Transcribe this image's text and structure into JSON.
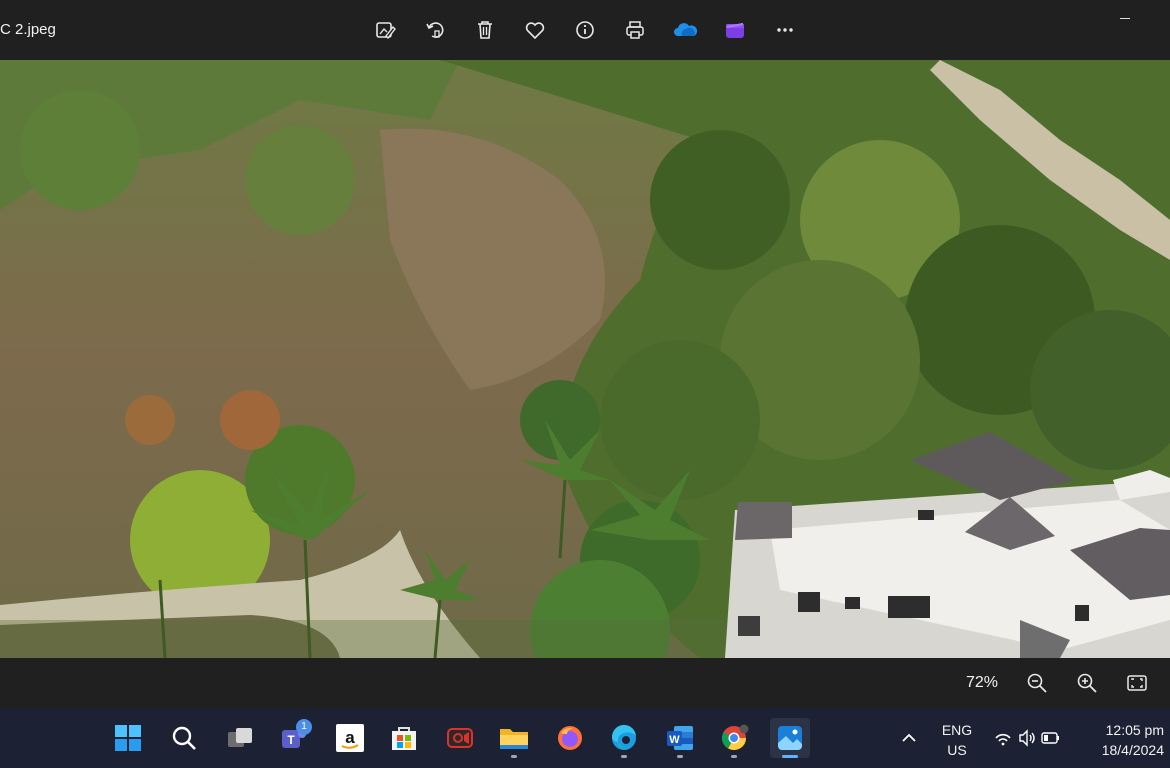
{
  "window": {
    "title": "C 2.jpeg"
  },
  "toolbar": {
    "icons": [
      "edit-image-icon",
      "rotate-icon",
      "delete-icon",
      "favorite-icon",
      "info-icon",
      "print-icon",
      "onedrive-icon",
      "clipchamp-icon",
      "more-icon"
    ]
  },
  "photo": {
    "subject": "aerial view of hillside with trees and unfinished building"
  },
  "status_bar": {
    "zoom_label": "72%"
  },
  "taskbar": {
    "apps": [
      "start",
      "search",
      "task-view",
      "teams",
      "amazon",
      "store",
      "screen-recorder",
      "file-explorer",
      "firefox",
      "edge",
      "word",
      "chrome",
      "photos"
    ],
    "teams_badge": "1",
    "language": "ENG",
    "region": "US",
    "time": "12:05 pm",
    "date": "18/4/2024"
  },
  "colors": {
    "accent": "#5fb2ff",
    "titlebar": "#202020",
    "taskbar": "#1c2233"
  }
}
